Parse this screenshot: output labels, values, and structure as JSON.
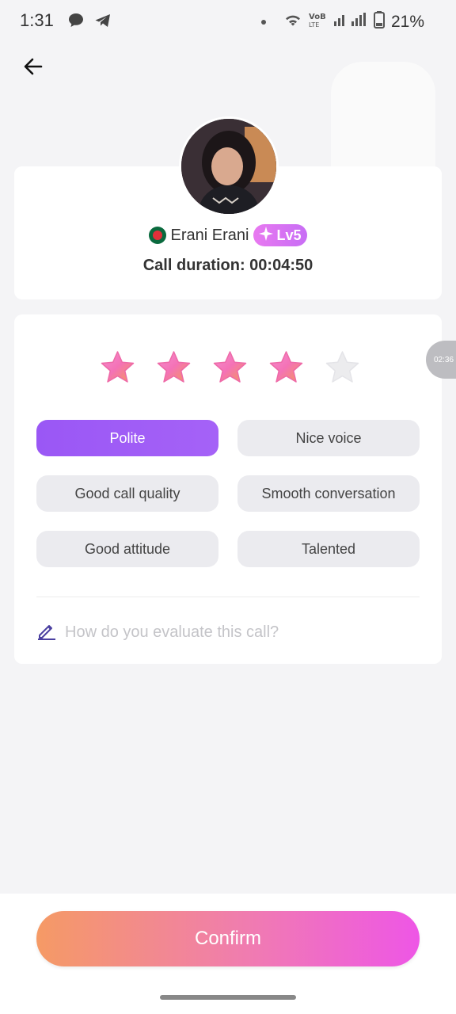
{
  "status_bar": {
    "time": "1:31",
    "battery": "21%",
    "icons": [
      "chat-bubble-icon",
      "telegram-icon",
      "notification-dot-icon",
      "wifi-icon",
      "volte-icon",
      "signal-icon",
      "battery-icon"
    ]
  },
  "nav": {
    "back_icon": "arrow-left-icon"
  },
  "profile": {
    "name": "Erani Erani",
    "level": "Lv5",
    "flag": "bangladesh-flag-icon",
    "call_duration": "Call duration: 00:04:50"
  },
  "rating": {
    "stars_filled": 4,
    "stars_total": 5,
    "star_color": "#f472b6",
    "empty_star_color": "#ececee"
  },
  "tags": [
    {
      "label": "Polite",
      "selected": true
    },
    {
      "label": "Nice voice",
      "selected": false
    },
    {
      "label": "Good call quality",
      "selected": false
    },
    {
      "label": "Smooth conversation",
      "selected": false
    },
    {
      "label": "Good attitude",
      "selected": false
    },
    {
      "label": "Talented",
      "selected": false
    }
  ],
  "evaluation": {
    "placeholder": "How do you evaluate this call?",
    "icon": "pencil-icon"
  },
  "floating_timer": "02:36",
  "confirm_label": "Confirm",
  "colors": {
    "accent_purple": "#9a57f5",
    "confirm_gradient_start": "#f59a65",
    "confirm_gradient_end": "#ee56e6"
  }
}
